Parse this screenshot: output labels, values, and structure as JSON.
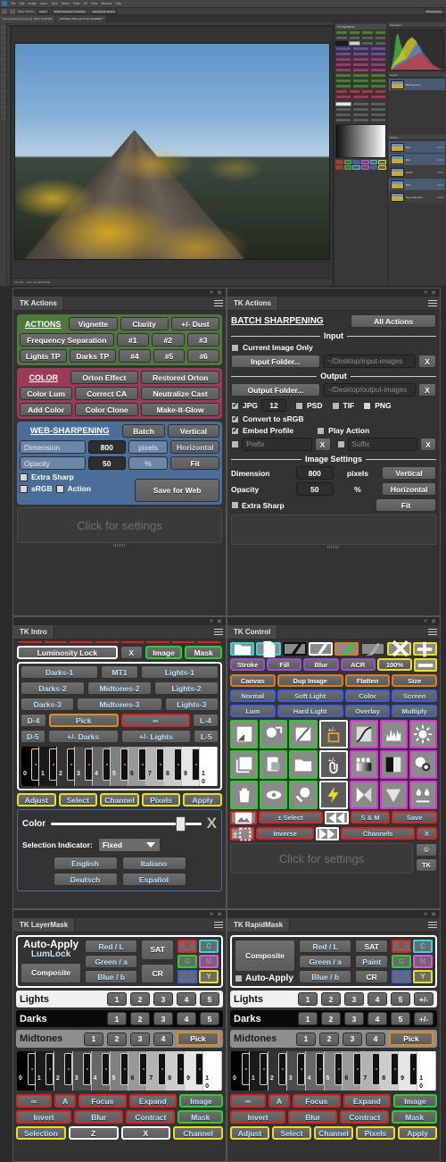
{
  "photoshop": {
    "menus": [
      "File",
      "Edit",
      "Image",
      "Layer",
      "Type",
      "Select",
      "Filter",
      "3D",
      "View",
      "Window",
      "Help"
    ],
    "options": [
      "Auto-Select:",
      "Layer",
      "Show Transform Controls",
      "Sample All Layers"
    ],
    "workspace_label": "Photography",
    "doc_tab_1": "Name-Sharpened.psd @ 100% (RGB/8#)",
    "doc_tab_2": "_DSC0601.DNG @ 23.5% (RGB/8#) *",
    "status_zoom": "23.52%",
    "status_doc": "Doc: 50.1M/167.9M",
    "tk_dock_tab": "TK RapidMask",
    "histogram_title": "Histogram",
    "layers_title": "Layers",
    "history_title": "History",
    "layer_rows": [
      {
        "name": "Blur",
        "meta": "Ctrl-1"
      },
      {
        "name": "Blur",
        "meta": "Ctrl-2"
      },
      {
        "name": "Smart",
        "meta": "Ctrl-3"
      },
      {
        "name": "Blur",
        "meta": "Ctrl-4"
      },
      {
        "name": "New Selection",
        "meta": "Ctrl-5"
      }
    ],
    "layer_panel_row": "Background"
  },
  "tk_actions_left": {
    "topbar": {
      "collapse": "«",
      "close": "✕"
    },
    "tab": "TK Actions",
    "actions": {
      "title": "ACTIONS",
      "color": "#4d7a3b",
      "row1": [
        "Vignette",
        "Clarity",
        "+/- Dust"
      ],
      "row2": [
        "Frequency Separation",
        "#1",
        "#2",
        "#3"
      ],
      "row3": [
        "Lights TP",
        "Darks TP",
        "#4",
        "#5",
        "#6"
      ]
    },
    "color": {
      "title": "COLOR",
      "color": "#9c3b57",
      "row1": [
        "Orton Effect",
        "Restored Orton"
      ],
      "row2": [
        "Color Lum",
        "Correct CA",
        "Neutralize Cast"
      ],
      "row3": [
        "Add Color",
        "Color Clone",
        "Make-It-Glow"
      ]
    },
    "web": {
      "title": "WEB-SHARPENING",
      "color": "#4a6d99",
      "batch": "Batch",
      "vertical": "Vertical",
      "dimension_label": "Dimension",
      "dimension_value": "800",
      "pixels_label": "pixels",
      "horizontal": "Horizontal",
      "opacity_label": "Opacity",
      "opacity_value": "50",
      "percent_label": "%",
      "fit": "Fit",
      "extra_sharp": "Extra Sharp",
      "srgb": "sRGB",
      "action": "Action",
      "save_for_web": "Save for Web"
    },
    "settings_hint": "Click for settings"
  },
  "tk_actions_right": {
    "tab": "TK Actions",
    "title": "BATCH SHARPENING",
    "all_actions": "All Actions",
    "input_legend": "Input",
    "current_image_only": "Current Image Only",
    "input_folder_btn": "Input Folder...",
    "input_folder_path": "~/Desktop/input-images",
    "input_clear": "X",
    "output_legend": "Output",
    "output_folder_btn": "Output Folder...",
    "output_folder_path": "~/Desktop/output-images",
    "output_clear": "X",
    "formats": [
      {
        "label": "JPG",
        "checked": true
      },
      {
        "label": "PSD",
        "checked": false
      },
      {
        "label": "TIF",
        "checked": false
      },
      {
        "label": "PNG",
        "checked": false
      }
    ],
    "jpg_quality": "12",
    "convert_srgb": "Convert to sRGB",
    "embed_profile": "Embed Profile",
    "play_action": "Play Action",
    "prefix_placeholder": "Prefix",
    "prefix_clear": "X",
    "suffix_placeholder": "Suffix",
    "suffix_clear": "X",
    "image_settings_legend": "Image Settings",
    "dimension_label": "Dimension",
    "dimension_value": "800",
    "pixels_label": "pixels",
    "vertical": "Vertical",
    "opacity_label": "Opacity",
    "opacity_value": "50",
    "percent_label": "%",
    "horizontal": "Horizontal",
    "extra_sharp": "Extra Sharp",
    "fit": "Fit"
  },
  "tk_intro": {
    "tab": "TK Intro",
    "lum_lock": "Luminosity Lock",
    "x": "X",
    "image": "Image",
    "mask": "Mask",
    "row_a": [
      "Darks-1",
      "MT1",
      "Lights-1"
    ],
    "row_b": [
      "Darks-2",
      "Midtones-2",
      "Lights-2"
    ],
    "row_c": [
      "Darks-3",
      "Midtones-3",
      "Lights-3"
    ],
    "row_d": [
      "D-4",
      "Pick",
      "∞",
      "L-4"
    ],
    "row_e": [
      "D-5",
      "+/- Darks",
      "+/- Lights",
      "L-5"
    ],
    "piano_numbers": [
      "0",
      "1",
      "2",
      "3",
      "4",
      "5",
      "6",
      "7",
      "8",
      "9",
      "10"
    ],
    "actions": [
      "Adjust",
      "Select",
      "Channel",
      "Pixels",
      "Apply"
    ],
    "color_label": "Color",
    "close_x": "X",
    "selection_indicator_label": "Selection Indicator:",
    "selection_indicator_value": "Fixed",
    "languages": [
      "English",
      "Italiano",
      "Deutsch",
      "Español"
    ]
  },
  "tk_control": {
    "tab": "TK Control",
    "icons_top": [
      "open-folder-icon",
      "new-document-icon",
      "brush-black-icon",
      "brush-white-icon",
      "brush-green-icon",
      "brush-gray-icon",
      "transform-icon",
      "zoom-in-icon"
    ],
    "row_stroke": [
      "Stroke",
      "Fill",
      "Blur",
      "ACR",
      "100%"
    ],
    "zoom_out_icon": "zoom-out-icon",
    "row_canvas": [
      "Canvas",
      "Dup Image",
      "Flatten",
      "Size"
    ],
    "row_blend1": [
      "Normal",
      "Soft Light",
      "Color",
      "Screen"
    ],
    "row_blend2": [
      "Lum",
      "Hard Light",
      "Overlay",
      "Multiply"
    ],
    "grid_left": [
      "add-layer-mask-icon",
      "apply-mask-icon",
      "disable-mask-icon",
      "new-layer-icon",
      "duplicate-layer-icon",
      "group-layer-icon",
      "delete-layer-icon",
      "hide-layer-icon",
      "inspect-layer-icon"
    ],
    "grid_mid": [
      "plus-minus-square-icon",
      "plus-minus-clip-icon",
      "lightning-icon"
    ],
    "grid_right": [
      "curves-icon",
      "levels-icon",
      "brightness-contrast-icon",
      "gradient-map-icon",
      "solid-color-icon",
      "selective-color-icon",
      "channel-mixer-icon",
      "gradient-fill-icon",
      "color-balance-icon"
    ],
    "row_bottom1": [
      "image-icon",
      "± Select",
      "rewind-icon",
      "S & M",
      "Save"
    ],
    "row_bottom2": [
      "select-pm-icon",
      "Inverse",
      "fast-forward-icon",
      "Channels",
      "X"
    ],
    "settings_hint": "Click for settings",
    "copyright_icon": "copyright-icon",
    "tk_badge": "TK"
  },
  "tk_layermask": {
    "tab": "TK LayerMask",
    "auto_apply": "Auto-Apply",
    "lum_lock": "LumLock",
    "composite": "Composite",
    "channels": [
      "Red / L",
      "Green / a",
      "Blue / b"
    ],
    "sat": "SAT",
    "cr": "CR",
    "rgbcmy": [
      {
        "label": "R",
        "color": "#e02020"
      },
      {
        "label": "C",
        "color": "#2fd8d8"
      },
      {
        "label": "G",
        "color": "#2ecc2e"
      },
      {
        "label": "M",
        "color": "#e84fe8"
      },
      {
        "label": "B",
        "color": "#3a5fe0"
      },
      {
        "label": "Y",
        "color": "#e8e020"
      }
    ],
    "lights": {
      "label": "Lights",
      "buttons": [
        "1",
        "2",
        "3",
        "4",
        "5"
      ]
    },
    "darks": {
      "label": "Darks",
      "buttons": [
        "1",
        "2",
        "3",
        "4",
        "5"
      ]
    },
    "midtones": {
      "label": "Midtones",
      "buttons": [
        "1",
        "2",
        "3",
        "4"
      ],
      "pick": "Pick"
    },
    "piano_numbers": [
      "0",
      "1",
      "2",
      "3",
      "4",
      "5",
      "6",
      "7",
      "8",
      "9",
      "10"
    ],
    "row1": [
      "∞",
      "A",
      "Focus",
      "Expand",
      "Image"
    ],
    "row2": [
      "Invert",
      "Blur",
      "Contract",
      "Mask"
    ],
    "row3": [
      "Selection",
      "Z",
      "X",
      "Channel"
    ]
  },
  "tk_rapidmask": {
    "tab": "TK RapidMask",
    "composite": "Composite",
    "auto_apply": "Auto-Apply",
    "channels": [
      "Red / L",
      "Green / a",
      "Blue / b"
    ],
    "sat": "SAT",
    "paint": "Paint",
    "cr": "CR",
    "rgbcmy": [
      {
        "label": "R",
        "color": "#e02020"
      },
      {
        "label": "C",
        "color": "#2fd8d8"
      },
      {
        "label": "G",
        "color": "#2ecc2e"
      },
      {
        "label": "M",
        "color": "#e84fe8"
      },
      {
        "label": "B",
        "color": "#3a5fe0"
      },
      {
        "label": "Y",
        "color": "#e8e020"
      }
    ],
    "lights": {
      "label": "Lights",
      "buttons": [
        "1",
        "2",
        "3",
        "4",
        "5",
        "+/-"
      ]
    },
    "darks": {
      "label": "Darks",
      "buttons": [
        "1",
        "2",
        "3",
        "4",
        "5",
        "+/-"
      ]
    },
    "midtones": {
      "label": "Midtones",
      "buttons": [
        "1",
        "2",
        "3",
        "4"
      ],
      "pick": "Pick"
    },
    "piano_numbers": [
      "0",
      "1",
      "2",
      "3",
      "4",
      "5",
      "6",
      "7",
      "8",
      "9",
      "10"
    ],
    "row1": [
      "∞",
      "A",
      "Focus",
      "Expand",
      "Image"
    ],
    "row2": [
      "Invert",
      "Blur",
      "Contract",
      "Mask"
    ],
    "row3": [
      "Adjust",
      "Select",
      "Channel",
      "Pixels",
      "Apply"
    ]
  }
}
